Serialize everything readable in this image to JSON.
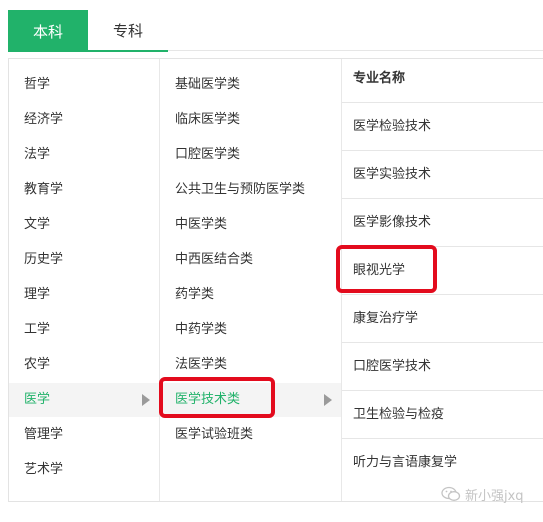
{
  "tabs": [
    {
      "label": "本科"
    },
    {
      "label": "专科"
    }
  ],
  "categories": [
    {
      "label": "哲学"
    },
    {
      "label": "经济学"
    },
    {
      "label": "法学"
    },
    {
      "label": "教育学"
    },
    {
      "label": "文学"
    },
    {
      "label": "历史学"
    },
    {
      "label": "理学"
    },
    {
      "label": "工学"
    },
    {
      "label": "农学"
    },
    {
      "label": "医学"
    },
    {
      "label": "管理学"
    },
    {
      "label": "艺术学"
    }
  ],
  "subcategories": [
    {
      "label": "基础医学类"
    },
    {
      "label": "临床医学类"
    },
    {
      "label": "口腔医学类"
    },
    {
      "label": "公共卫生与预防医学类"
    },
    {
      "label": "中医学类"
    },
    {
      "label": "中西医结合类"
    },
    {
      "label": "药学类"
    },
    {
      "label": "中药学类"
    },
    {
      "label": "法医学类"
    },
    {
      "label": "医学技术类"
    },
    {
      "label": "医学试验班类"
    }
  ],
  "majors": {
    "header": "专业名称",
    "items": [
      {
        "label": "医学检验技术"
      },
      {
        "label": "医学实验技术"
      },
      {
        "label": "医学影像技术"
      },
      {
        "label": "眼视光学"
      },
      {
        "label": "康复治疗学"
      },
      {
        "label": "口腔医学技术"
      },
      {
        "label": "卫生检验与检疫"
      },
      {
        "label": "听力与言语康复学"
      }
    ]
  },
  "selection": {
    "category": "医学",
    "subcategory": "医学技术类",
    "highlighted_major": "眼视光学"
  },
  "watermark": {
    "text": "新小强jxq",
    "icon": "wechat-icon"
  },
  "colors": {
    "accent": "#21b26a",
    "highlight": "#e30b1d"
  }
}
